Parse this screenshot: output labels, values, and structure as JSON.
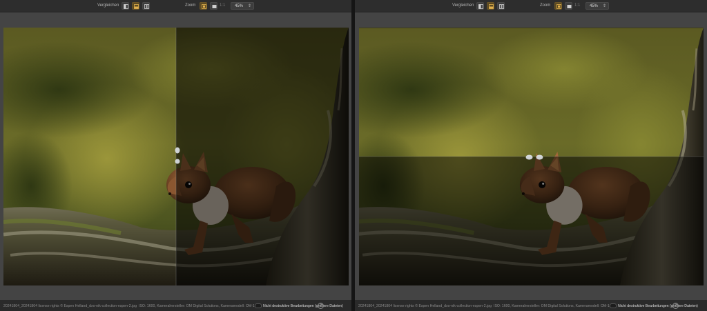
{
  "toolbar": {
    "compare_label": "Vergleichen",
    "zoom_label": "Zoom",
    "one_to_one": "1:1",
    "zoom_value": "45%",
    "zoom_chevron": "⇕",
    "compare_icons": [
      "split-vertical-icon",
      "split-horizontal-icon",
      "side-by-side-icon"
    ],
    "zoom_icons": [
      "fit-to-window-icon",
      "fill-window-icon"
    ]
  },
  "panes": [
    {
      "id": "left",
      "compare_mode": "vertical-split",
      "filename": "20241804_20241804 license rights © Espen Helland_dxo-nik-collection-espen-2.jpg",
      "metadata": "ISO: 1600, Kamerahersteller: OM Digital Solutions, Kameramodell: OM-1",
      "nondestructive_label": "Nicht destruktive Bearbeitungen (größere Dateien)",
      "help": "?"
    },
    {
      "id": "right",
      "compare_mode": "horizontal-split",
      "filename": "20241804_20241804 license rights © Espen Helland_dxo-nik-collection-espen-2.jpg",
      "metadata": "ISO: 1600, Kamerahersteller: OM Digital Solutions, Kameramodell: OM-1",
      "nondestructive_label": "Nicht destruktive Bearbeitungen (größere Dateien)",
      "help": "?"
    }
  ],
  "colors": {
    "accent": "#c08a2a",
    "bokeh_green": "#6f7a2c",
    "squirrel": "#7a4a26",
    "moss": "#4f5a24"
  }
}
